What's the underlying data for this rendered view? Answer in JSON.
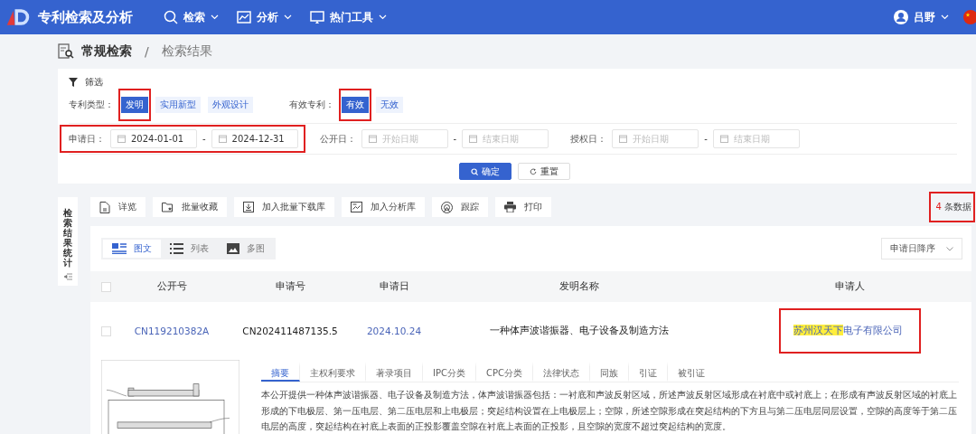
{
  "header": {
    "title": "专利检索及分析",
    "nav": [
      {
        "label": "检索"
      },
      {
        "label": "分析"
      },
      {
        "label": "热门工具"
      }
    ],
    "user": "吕野"
  },
  "breadcrumb": {
    "items": [
      "常规检索",
      "检索结果"
    ],
    "separator": "/"
  },
  "filter": {
    "title": "筛选",
    "groups": [
      {
        "label": "专利类型：",
        "options": [
          {
            "label": "发明",
            "selected": true,
            "outlined": true
          },
          {
            "label": "实用新型",
            "selected": false,
            "outlined": false
          },
          {
            "label": "外观设计",
            "selected": false,
            "outlined": false
          }
        ]
      },
      {
        "label": "有效专利：",
        "options": [
          {
            "label": "有效",
            "selected": true,
            "outlined": true
          },
          {
            "label": "无效",
            "selected": false,
            "outlined": false
          }
        ]
      }
    ],
    "date_ranges": [
      {
        "label": "申请日：",
        "start": {
          "value": "2024-01-01"
        },
        "end": {
          "value": "2024-12-31"
        },
        "dash": "-",
        "outlined": true
      },
      {
        "label": "公开日：",
        "start": {
          "placeholder": "开始日期"
        },
        "end": {
          "placeholder": "结束日期"
        },
        "dash": "-",
        "outlined": false
      },
      {
        "label": "授权日：",
        "start": {
          "placeholder": "开始日期"
        },
        "end": {
          "placeholder": "结束日期"
        },
        "dash": "-",
        "outlined": false
      }
    ],
    "confirm": "确定",
    "reset": "重置"
  },
  "side_tab": {
    "label": "检索结果统计"
  },
  "toolbar": [
    "详览",
    "批量收藏",
    "加入批量下载库",
    "加入分析库",
    "跟踪",
    "打印"
  ],
  "result_count": {
    "count": "4",
    "unit": "条数据",
    "outlined": true
  },
  "views": [
    {
      "label": "图文",
      "selected": true
    },
    {
      "label": "列表",
      "selected": false
    },
    {
      "label": "多图",
      "selected": false
    }
  ],
  "sort": {
    "value": "申请日降序"
  },
  "table": {
    "all_checked": false,
    "columns": [
      "公开号",
      "申请号",
      "申请日",
      "发明名称",
      "申请人"
    ],
    "rows": [
      {
        "checked": false,
        "pub_no": "CN119210382A",
        "app_no": "CN202411487135.5",
        "app_date": "2024.10.24",
        "title": "一种体声波谐振器、电子设备及制造方法",
        "applicant": {
          "highlight": "苏州汉天下",
          "rest": "电子有限公司",
          "outlined": true
        },
        "detail_tabs": [
          {
            "label": "摘要",
            "selected": true
          },
          {
            "label": "主权利要求",
            "selected": false
          },
          {
            "label": "著录项目",
            "selected": false
          },
          {
            "label": "IPC分类",
            "selected": false
          },
          {
            "label": "CPC分类",
            "selected": false
          },
          {
            "label": "法律状态",
            "selected": false
          },
          {
            "label": "同族",
            "selected": false
          },
          {
            "label": "引证",
            "selected": false
          },
          {
            "label": "被引证",
            "selected": false
          }
        ],
        "abstract": "本公开提供一种体声波谐振器、电子设备及制造方法，体声波谐振器包括：一衬底和声波反射区域，所述声波反射区域形成在衬底中或衬底上；在形成有声波反射区域的衬底上形成的下电极层、第一压电层、第二压电层和上电极层；突起结构设置在上电极层上；空隙，所述空隙形成在突起结构的下方且与第二压电层同层设置，空隙的高度等于第二压电层的高度，突起结构在衬底上表面的正投影覆盖空隙在衬底上表面的正投影，且空隙的宽度不超过突起结构的宽度。"
      }
    ]
  }
}
